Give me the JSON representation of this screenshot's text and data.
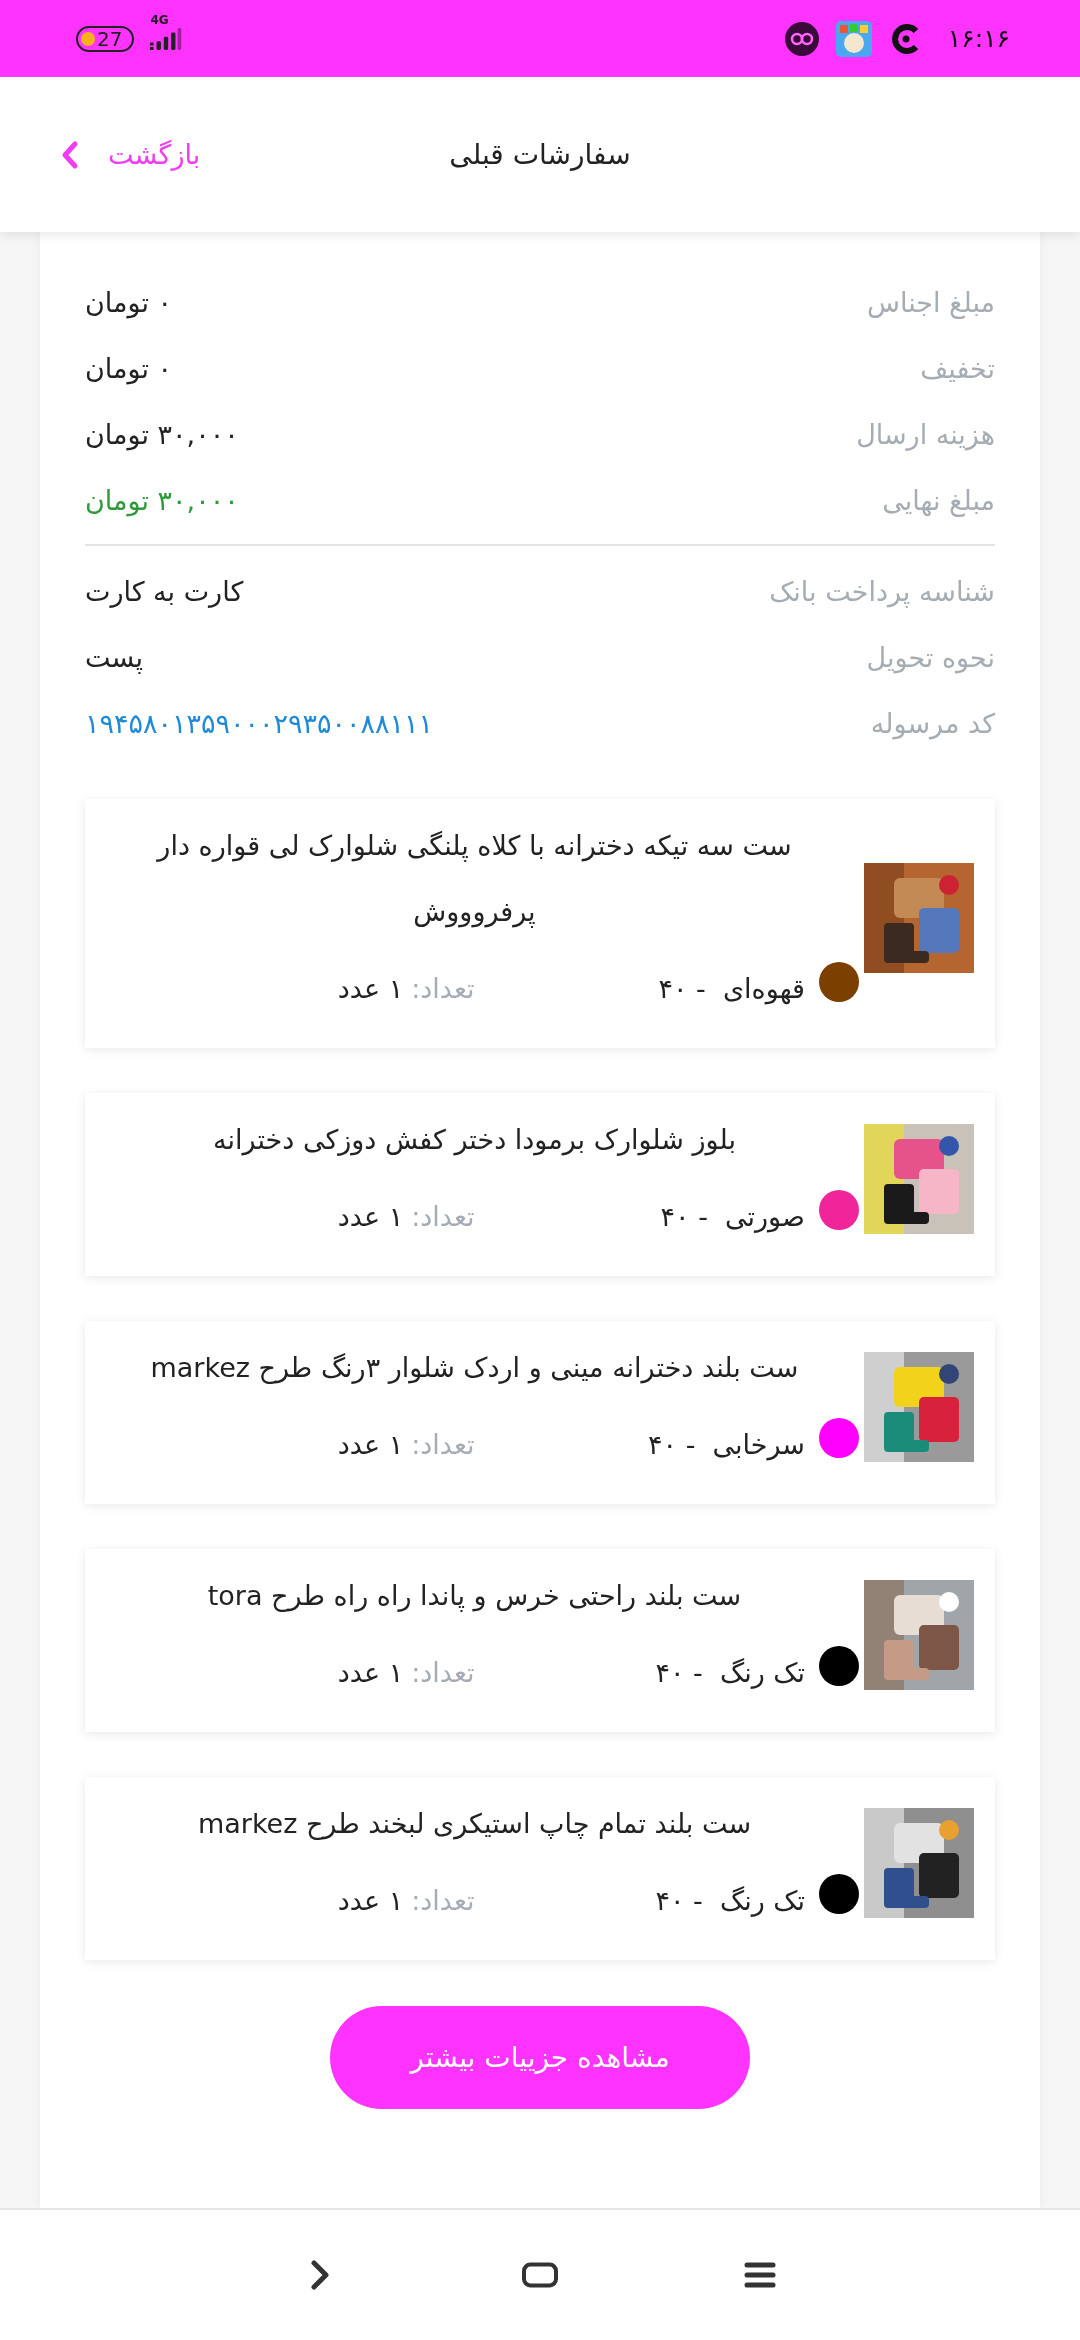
{
  "status_bar": {
    "time": "۱۶:۱۶",
    "network": "4G",
    "battery": "27"
  },
  "header": {
    "title": "سفارشات قبلی",
    "back": "بازگشت"
  },
  "summary": [
    {
      "label": "مبلغ اجناس",
      "value": "۰ تومان",
      "kind": "amount"
    },
    {
      "label": "تخفیف",
      "value": "۰ تومان",
      "kind": "amount"
    },
    {
      "label": "هزینه ارسال",
      "value": "۳۰,۰۰۰ تومان",
      "kind": "amount"
    },
    {
      "label": "مبلغ نهایی",
      "value": "۳۰,۰۰۰ تومان",
      "kind": "total"
    }
  ],
  "details": [
    {
      "label": "شناسه پرداخت بانک",
      "value": "کارت به کارت",
      "kind": "text"
    },
    {
      "label": "نحوه تحویل",
      "value": "پست",
      "kind": "text"
    },
    {
      "label": "کد مرسوله",
      "value": "۱۹۴۵۸۰۱۳۵۹۰۰۰۲۹۳۵۰۰۸۸۱۱۱",
      "kind": "code"
    }
  ],
  "items": [
    {
      "title": "ست سه تیکه دخترانه با کلاه پلنگی شلوارک لی قواره دار پرفروووش",
      "variant": "قهوه‌ای  - ۴۰",
      "color": "#7b3f00",
      "quantity_label": "تعداد:",
      "quantity": "۱ عدد"
    },
    {
      "title": "بلوز شلوارک برمودا دختر کفش دوزکی دخترانه",
      "variant": "صورتی  - ۴۰",
      "color": "#f0259a",
      "quantity_label": "تعداد:",
      "quantity": "۱ عدد"
    },
    {
      "title": "ست بلند دخترانه مینی و اردک شلوار ۳رنگ طرح markez",
      "variant": "سرخابی  - ۴۰",
      "color": "#ff00ff",
      "quantity_label": "تعداد:",
      "quantity": "۱ عدد"
    },
    {
      "title": "ست بلند راحتی خرس و پاندا راه راه طرح tora",
      "variant": "تک رنگ  - ۴۰",
      "color": "#000000",
      "quantity_label": "تعداد:",
      "quantity": "۱ عدد"
    },
    {
      "title": "ست بلند تمام چاپ استیکری لبخند طرح markez",
      "variant": "تک رنگ  - ۴۰",
      "color": "#000000",
      "quantity_label": "تعداد:",
      "quantity": "۱ عدد"
    }
  ],
  "more_button": "مشاهده جزییات بیشتر"
}
